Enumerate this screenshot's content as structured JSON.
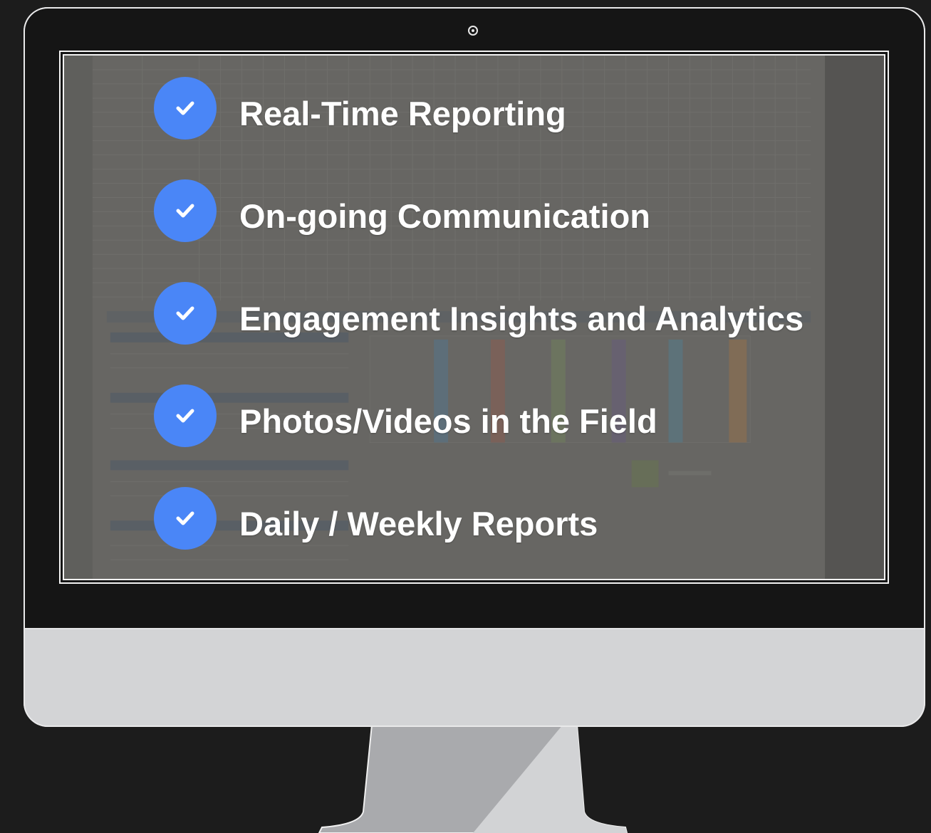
{
  "accent_color": "#4a86f7",
  "features": [
    {
      "label": "Real-Time Reporting",
      "icon": "check-icon"
    },
    {
      "label": "On-going Communication",
      "icon": "check-icon"
    },
    {
      "label": "Engagement Insights and Analytics",
      "icon": "check-icon"
    },
    {
      "label": "Photos/Videos in the Field",
      "icon": "check-icon"
    },
    {
      "label": "Daily / Weekly Reports",
      "icon": "check-icon"
    }
  ]
}
